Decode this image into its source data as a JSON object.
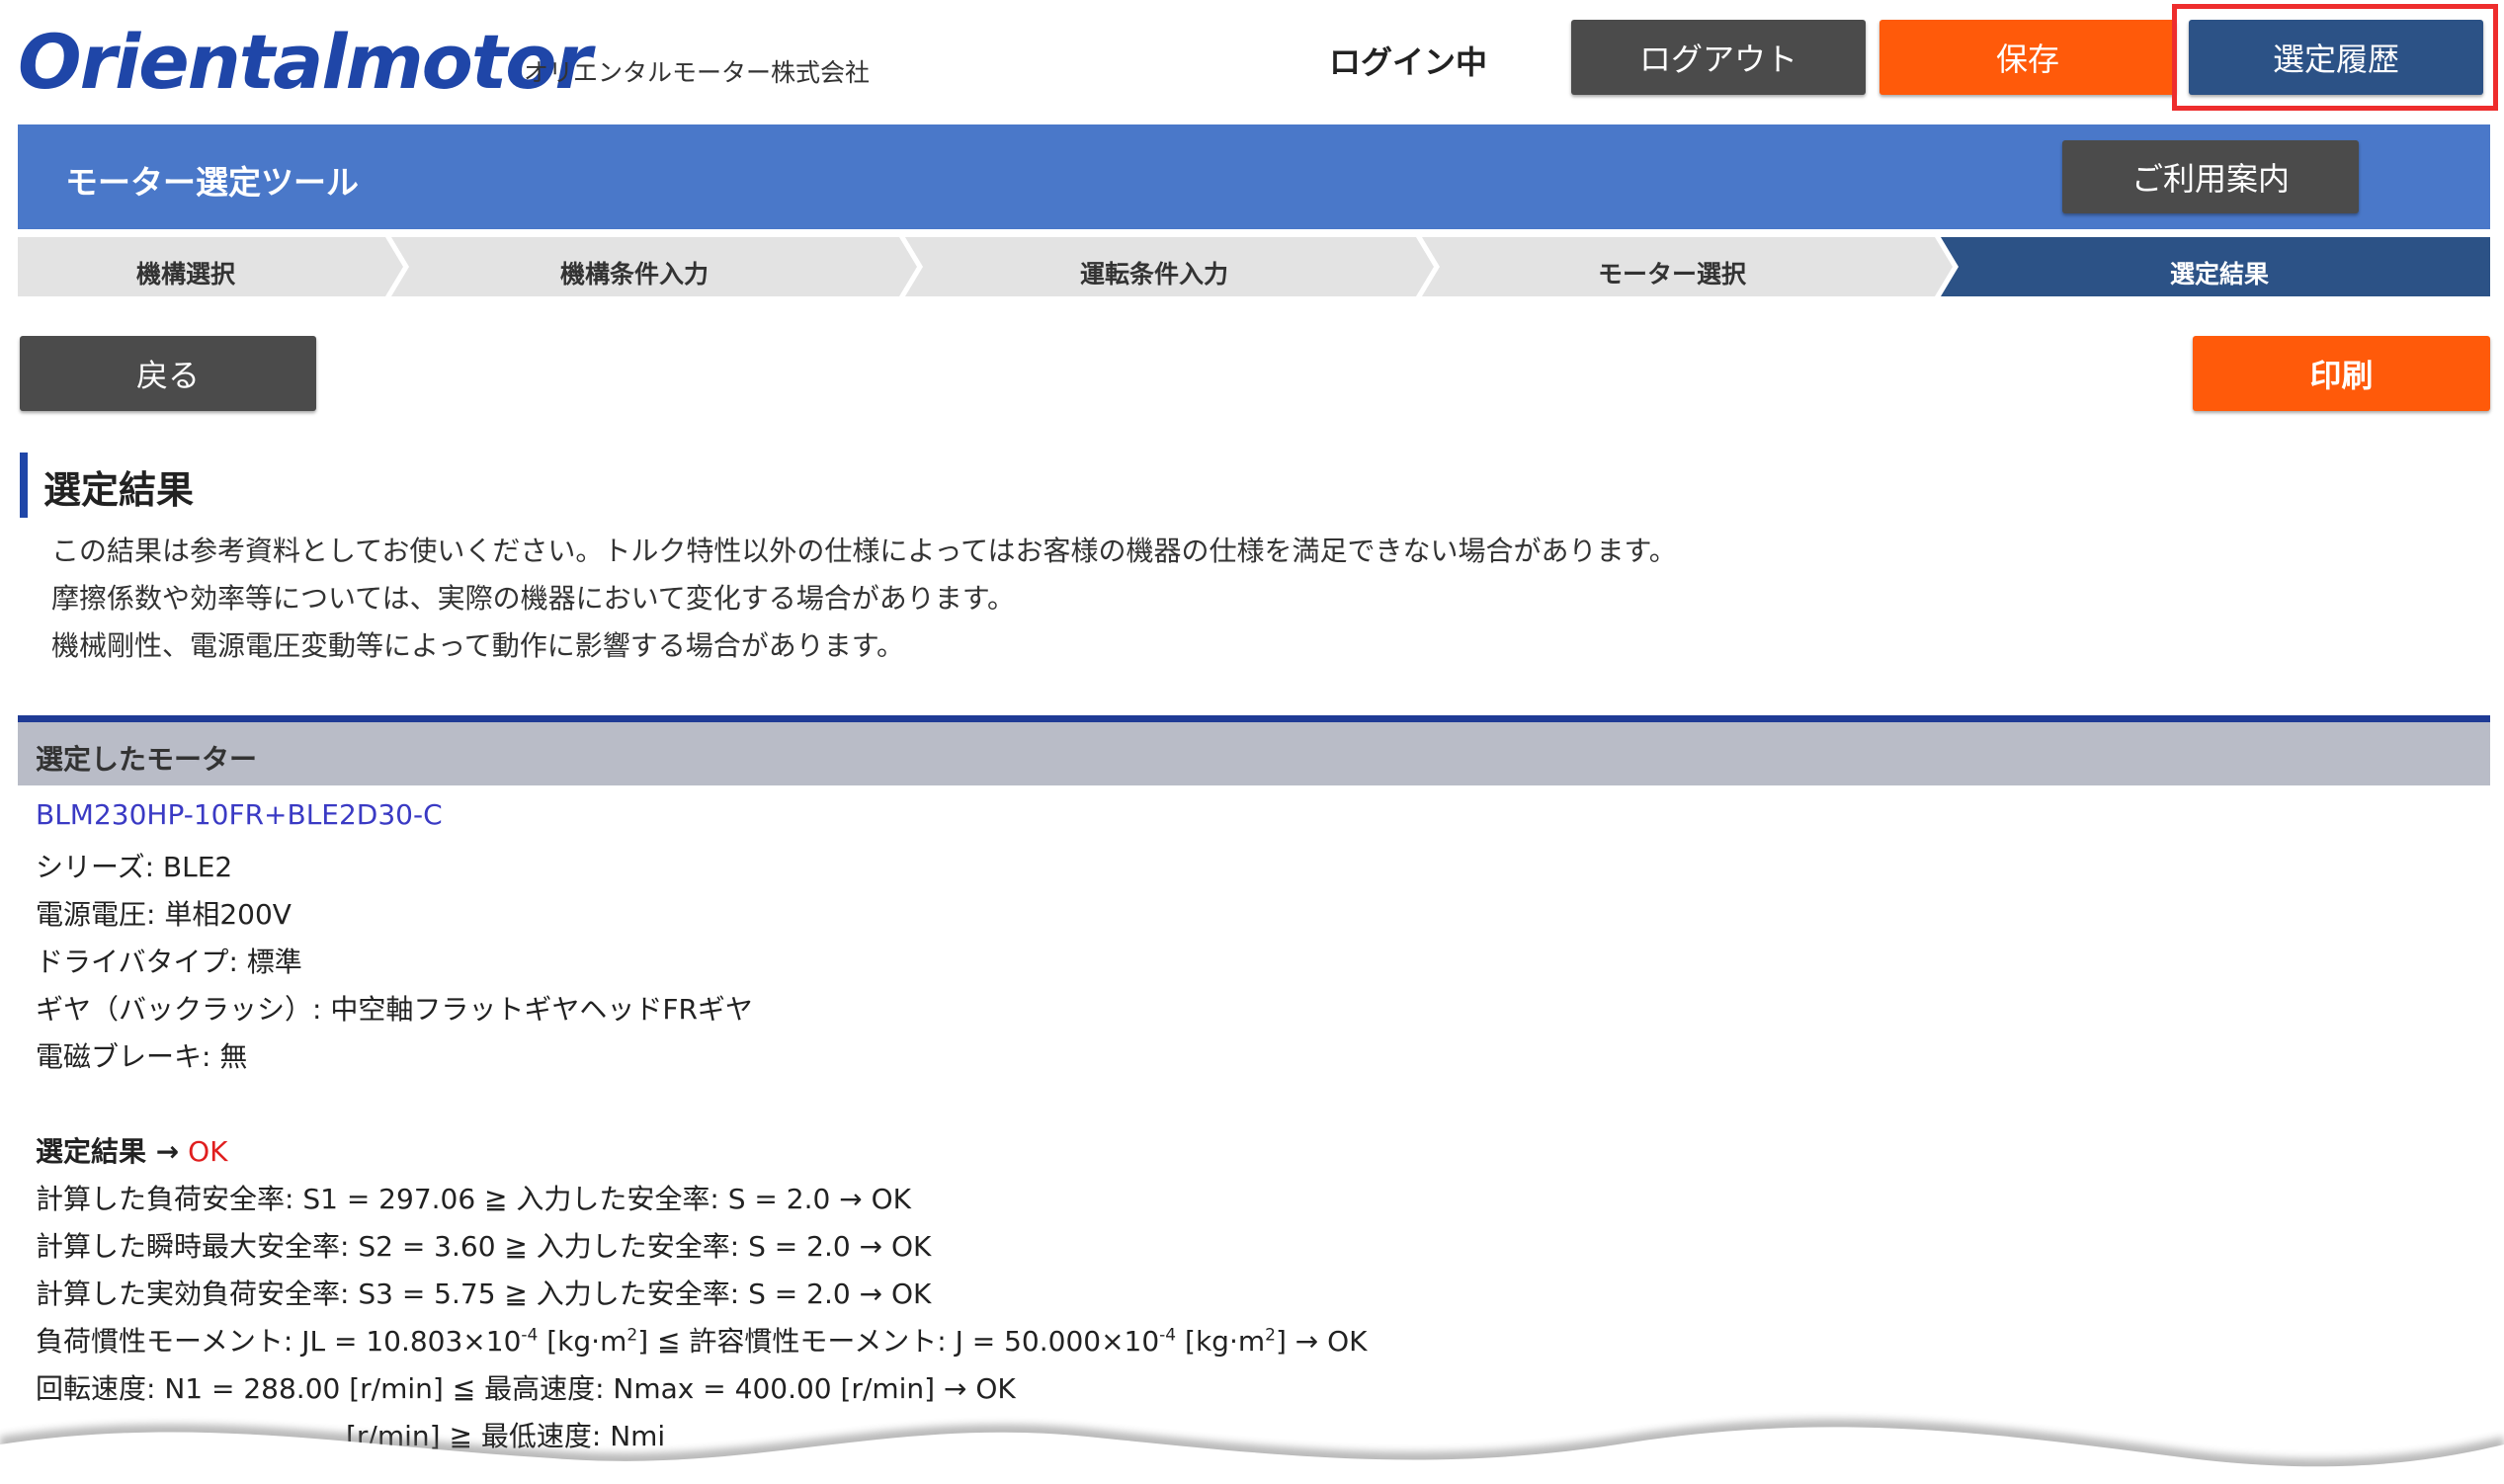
{
  "header": {
    "logo": "Orientalmotor",
    "company": "オリエンタルモーター株式会社",
    "login_status": "ログイン中",
    "logout_label": "ログアウト",
    "save_label": "保存",
    "history_label": "選定履歴"
  },
  "banner": {
    "title": "モーター選定ツール",
    "guide_label": "ご利用案内"
  },
  "steps": [
    "機構選択",
    "機構条件入力",
    "運転条件入力",
    "モーター選択",
    "選定結果"
  ],
  "actions": {
    "back_label": "戻る",
    "print_label": "印刷"
  },
  "section": {
    "title": "選定結果",
    "notes": [
      "この結果は参考資料としてお使いください。トルク特性以外の仕様によってはお客様の機器の仕様を満足できない場合があります。",
      "摩擦係数や効率等については、実際の機器において変化する場合があります。",
      "機械剛性、電源電圧変動等によって動作に影響する場合があります。"
    ]
  },
  "motor": {
    "heading": "選定したモーター",
    "model": "BLM230HP-10FR+BLE2D30-C",
    "series": "シリーズ: BLE2",
    "voltage": "電源電圧: 単相200V",
    "driver": "ドライバタイプ: 標準",
    "gear": "ギヤ（バックラッシ）: 中空軸フラットギヤヘッドFRギヤ",
    "brake": "電磁ブレーキ: 無"
  },
  "result": {
    "label": "選定結果 →",
    "status": "OK",
    "s1": "計算した負荷安全率: S1 = 297.06 ≧ 入力した安全率: S = 2.0 → OK",
    "s2": "計算した瞬時最大安全率: S2 = 3.60 ≧ 入力した安全率: S = 2.0 → OK",
    "s3": "計算した実効負荷安全率: S3 = 5.75 ≧ 入力した安全率: S = 2.0 → OK",
    "inertia_a": "負荷慣性モーメント: JL = 10.803×10",
    "inertia_exp1": "-4",
    "inertia_b": " [kg·m",
    "inertia_exp2": "2",
    "inertia_c": "] ≦ 許容慣性モーメント: J = 50.000×10",
    "inertia_exp3": "-4",
    "inertia_d": " [kg·m",
    "inertia_exp4": "2",
    "inertia_e": "] → OK",
    "speed": "回転速度: N1 = 288.00 [r/min] ≦ 最高速度: Nmax = 400.00 [r/min] → OK",
    "partial": "[r/min] ≧ 最低速度: Nmi"
  }
}
